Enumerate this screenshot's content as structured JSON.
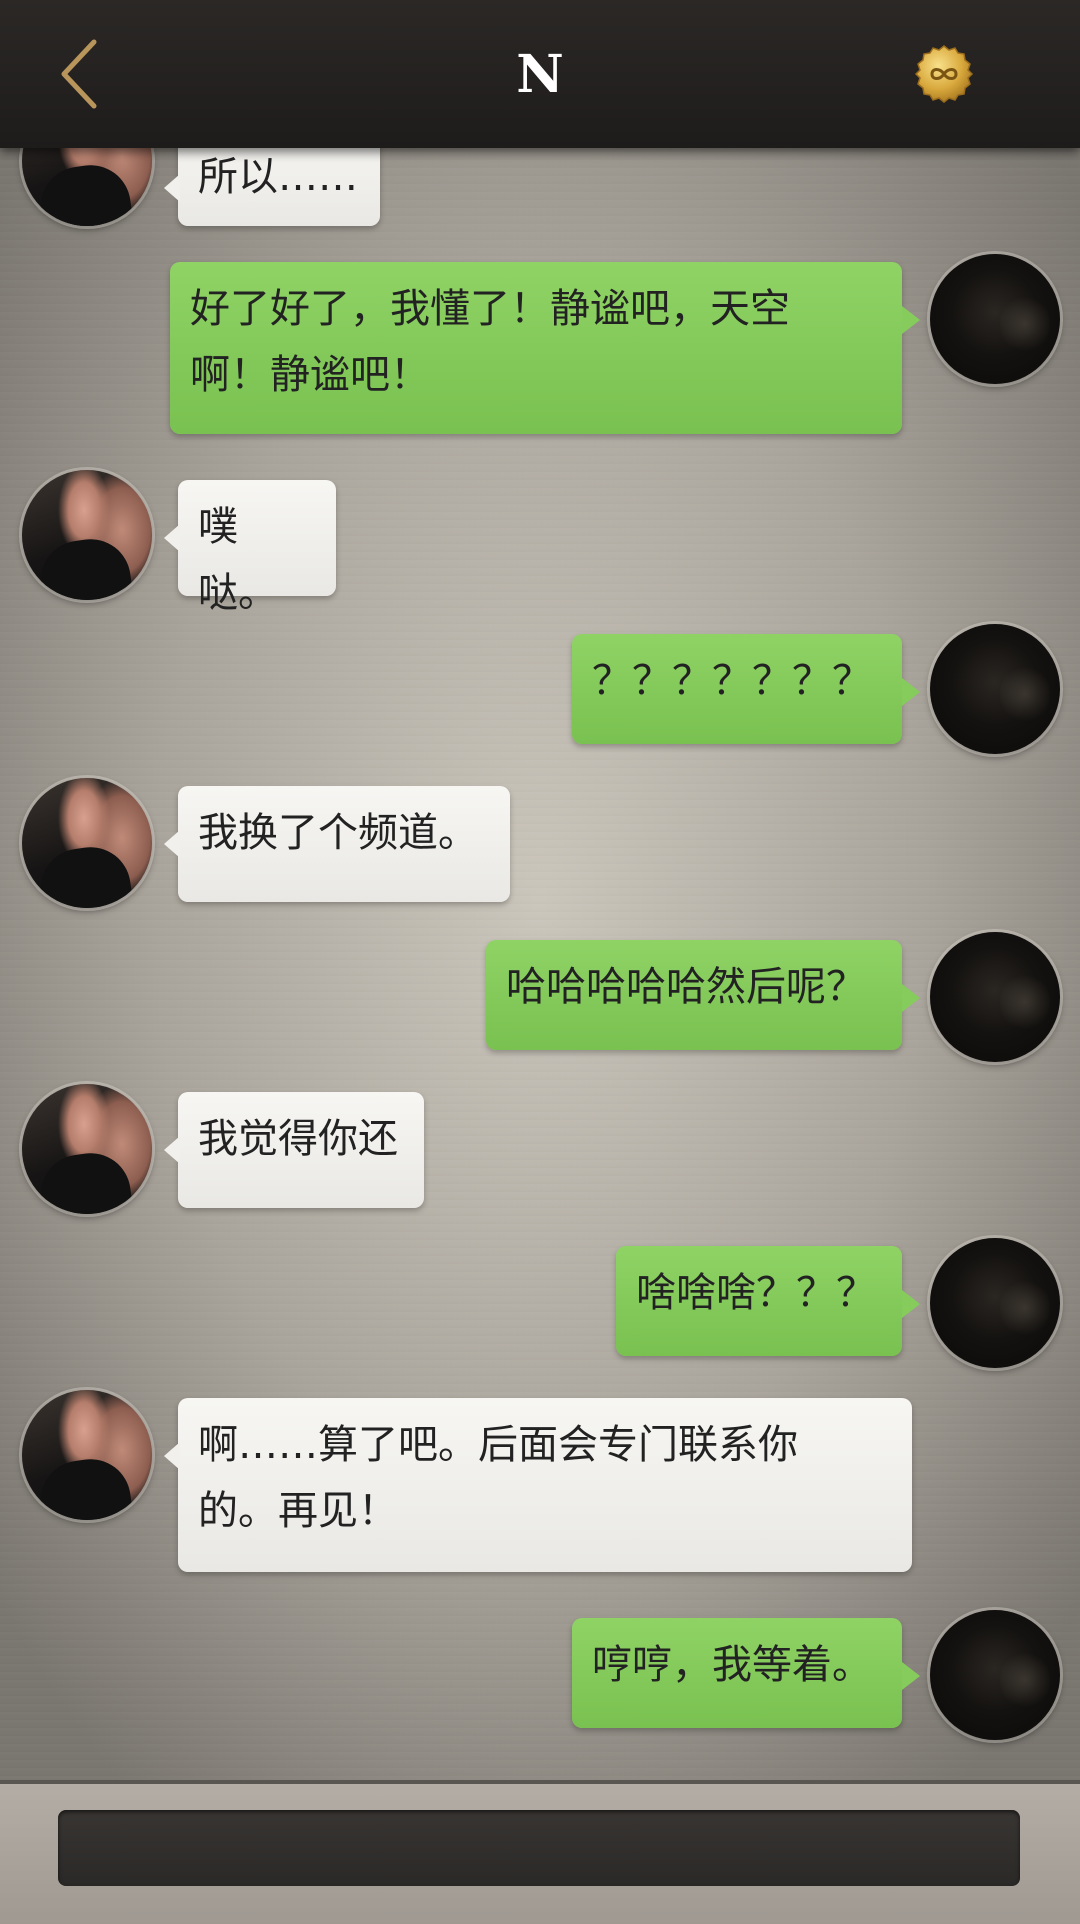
{
  "header": {
    "title": "N",
    "back_icon": "chevron-left-icon",
    "coin_icon": "infinity-coin-icon",
    "accent_color": "#b8955a"
  },
  "messages": [
    {
      "side": "in",
      "text": "所以……"
    },
    {
      "side": "out",
      "text": "好了好了，我懂了！静谧吧，天空\n啊！静谧吧！"
    },
    {
      "side": "in",
      "text": "噗哒。"
    },
    {
      "side": "out",
      "text": "？？？？？？？"
    },
    {
      "side": "in",
      "text": "我换了个频道。"
    },
    {
      "side": "out",
      "text": "哈哈哈哈哈然后呢？"
    },
    {
      "side": "in",
      "text": "我觉得你还"
    },
    {
      "side": "out",
      "text": "啥啥啥？？？"
    },
    {
      "side": "in",
      "text": "啊……算了吧。后面会专门联系你\n的。再见！"
    },
    {
      "side": "out",
      "text": "哼哼，我等着。"
    }
  ],
  "colors": {
    "incoming_bubble": "#f1f0ec",
    "outgoing_bubble": "#86cc5c",
    "header_bg": "#232120"
  },
  "input": {
    "value": "",
    "placeholder": ""
  }
}
